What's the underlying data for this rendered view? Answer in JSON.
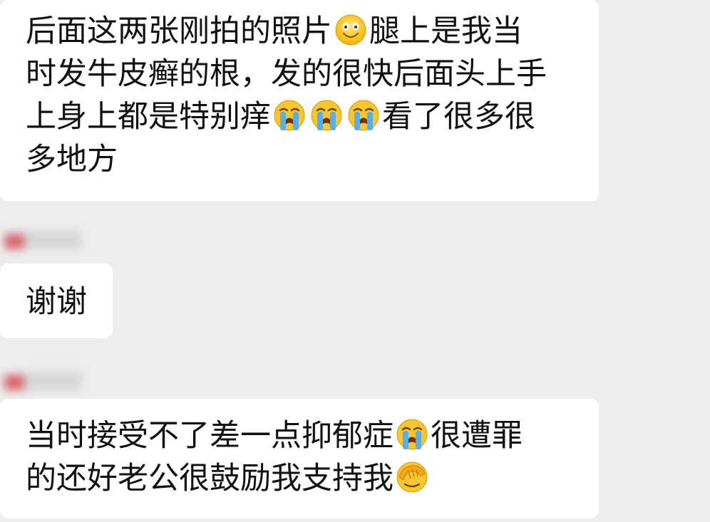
{
  "messages": [
    {
      "lines": [
        {
          "a": "后面这两张刚拍的照片",
          "emoji": "smiling-face-icon",
          "b": "腿上是我当"
        },
        {
          "a": "时发牛皮癣的根，发的很快后面头上手"
        },
        {
          "a": "上身上都是特别痒",
          "emoji3": "loudly-crying-face-icon",
          "b": "看了很多很"
        },
        {
          "a": "多地方"
        }
      ]
    },
    {
      "lines": [
        {
          "a": "谢谢"
        }
      ]
    },
    {
      "lines": [
        {
          "a": "当时接受不了差一点抑郁症",
          "emoji": "loudly-crying-face-icon",
          "b": "很遭罪"
        },
        {
          "a": "的还好老公很鼓励我支持我",
          "emoji": "face-palm-icon"
        }
      ]
    }
  ],
  "colors": {
    "background": "#ededed",
    "bubble": "#ffffff",
    "text": "#111111"
  }
}
